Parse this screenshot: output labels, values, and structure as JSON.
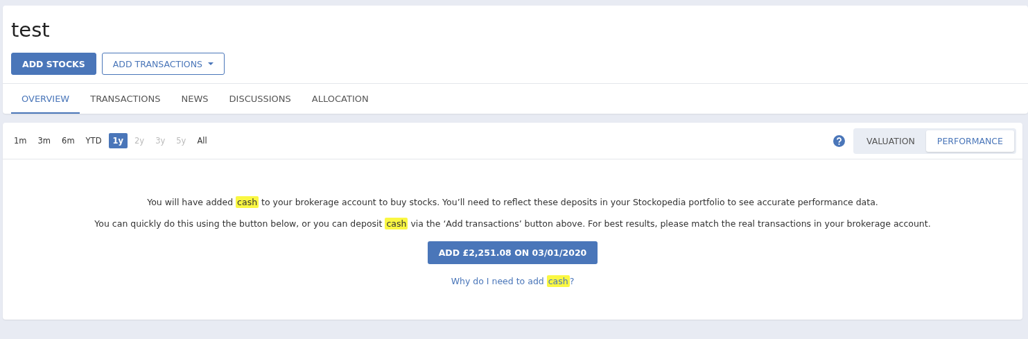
{
  "title": "test",
  "actions": [
    {
      "label": "ADD STOCKS",
      "kind": "primary"
    },
    {
      "label": "ADD TRANSACTIONS",
      "kind": "dropdown"
    }
  ],
  "tabs": [
    {
      "label": "OVERVIEW",
      "selected": true
    },
    {
      "label": "TRANSACTIONS",
      "selected": false
    },
    {
      "label": "NEWS",
      "selected": false
    },
    {
      "label": "DISCUSSIONS",
      "selected": false
    },
    {
      "label": "ALLOCATION",
      "selected": false
    }
  ],
  "periods": [
    {
      "label": "1m",
      "selected": false,
      "disabled": false
    },
    {
      "label": "3m",
      "selected": false,
      "disabled": false
    },
    {
      "label": "6m",
      "selected": false,
      "disabled": false
    },
    {
      "label": "YTD",
      "selected": false,
      "disabled": false
    },
    {
      "label": "1y",
      "selected": true,
      "disabled": false
    },
    {
      "label": "2y",
      "selected": false,
      "disabled": true
    },
    {
      "label": "3y",
      "selected": false,
      "disabled": true
    },
    {
      "label": "5y",
      "selected": false,
      "disabled": true
    },
    {
      "label": "All",
      "selected": false,
      "disabled": false
    }
  ],
  "view_toggle": [
    {
      "label": "VALUATION",
      "selected": false
    },
    {
      "label": "PERFORMANCE",
      "selected": true
    }
  ],
  "paragraphs": [
    [
      {
        "text": "You will have added ",
        "highlighted": false
      },
      {
        "text": "cash",
        "highlighted": true
      },
      {
        "text": " to your brokerage account to buy stocks. You’ll need to reflect these deposits in your Stockopedia portfolio to see accurate performance data.",
        "highlighted": false
      }
    ],
    [
      {
        "text": "You can quickly do this using the button below, or you can deposit ",
        "highlighted": false
      },
      {
        "text": "cash",
        "highlighted": true
      },
      {
        "text": " via the ‘Add transactions’ button above. For best results, please match the real transactions in your brokerage account.",
        "highlighted": false
      }
    ]
  ],
  "add_cash_button": "ADD £2,251.08 ON 03/01/2020",
  "help_link": [
    {
      "text": "Why do I need to add ",
      "highlighted": false
    },
    {
      "text": "cash",
      "highlighted": true
    },
    {
      "text": "?",
      "highlighted": false
    }
  ]
}
